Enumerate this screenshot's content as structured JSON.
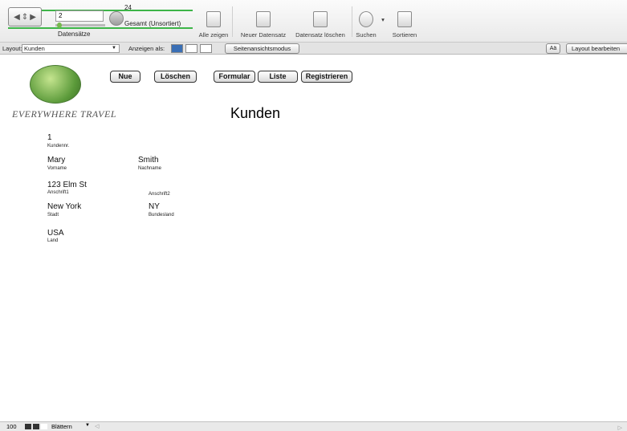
{
  "toolbar": {
    "record_number": "2",
    "record_total": "24",
    "record_status": "Gesamt (Unsortiert)",
    "records_label": "Datensätze",
    "buttons": {
      "show_all": "Alle zeigen",
      "new_record": "Neuer Datensatz",
      "delete_record": "Datensatz löschen",
      "find": "Suchen",
      "sort": "Sortieren"
    }
  },
  "layoutbar": {
    "layout_label": "Layout:",
    "layout_value": "Kunden",
    "view_as_label": "Anzeigen als:",
    "page_view_label": "Seitenansichtsmodus",
    "aa_label": "Aä",
    "edit_layout_label": "Layout bearbeiten"
  },
  "content": {
    "logo_text": "EVERYWHERE TRAVEL",
    "title": "Kunden",
    "buttons": {
      "new": "Nue",
      "delete": "Löschen",
      "form": "Formular",
      "list": "Liste",
      "register": "Registrieren"
    },
    "fields": {
      "customer_no_value": "1",
      "customer_no_label": "Kundennr.",
      "firstname_value": "Mary",
      "firstname_label": "Vorname",
      "lastname_value": "Smith",
      "lastname_label": "Nachname",
      "address1_value": "123 Elm St",
      "address1_label": "Anschrift1",
      "address2_label": "Anschrift2",
      "city_value": "New York",
      "city_label": "Stadt",
      "state_value": "NY",
      "state_label": "Bundesland",
      "country_value": "USA",
      "country_label": "Land"
    }
  },
  "statusbar": {
    "zoom": "100",
    "mode": "Blättern"
  },
  "colors": {
    "accent_green": "#3db548",
    "toolbar_bg": "#efefef",
    "layout_bar_bg": "#e3e3e3"
  }
}
